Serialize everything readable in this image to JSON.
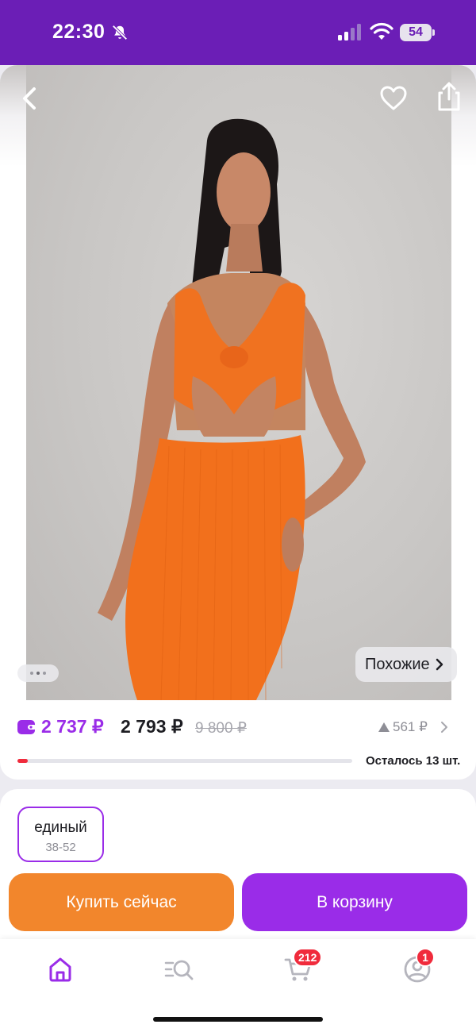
{
  "status_bar": {
    "time": "22:30",
    "battery": "54",
    "icons": [
      "bell-muted-icon",
      "cellular-signal-icon",
      "wifi-icon",
      "battery-icon"
    ]
  },
  "product_header": {
    "icons": [
      "chevron-left-icon",
      "heart-icon",
      "share-icon"
    ]
  },
  "gallery": {
    "similar_label": "Похожие",
    "page_count": 3,
    "active_page": 2
  },
  "price": {
    "wallet_price": "2 737 ₽",
    "price": "2 793 ₽",
    "old_price": "9 800 ₽",
    "delta": "561 ₽",
    "stock_label": "Осталось 13 шт.",
    "stock_fraction": 0.03,
    "colors": {
      "accent": "#9a2ce8",
      "stock": "#f02b3c"
    }
  },
  "size": {
    "name": "единый",
    "range": "38-52"
  },
  "actions": {
    "buy_now": "Купить сейчас",
    "add_to_cart": "В корзину",
    "buy_color": "#f2862c",
    "cart_color": "#9a2ce8"
  },
  "tabbar": {
    "tabs": [
      {
        "icon": "home-icon",
        "active": true
      },
      {
        "icon": "catalog-search-icon",
        "active": false
      },
      {
        "icon": "cart-icon",
        "badge": "212"
      },
      {
        "icon": "profile-icon",
        "badge": "1"
      }
    ]
  }
}
